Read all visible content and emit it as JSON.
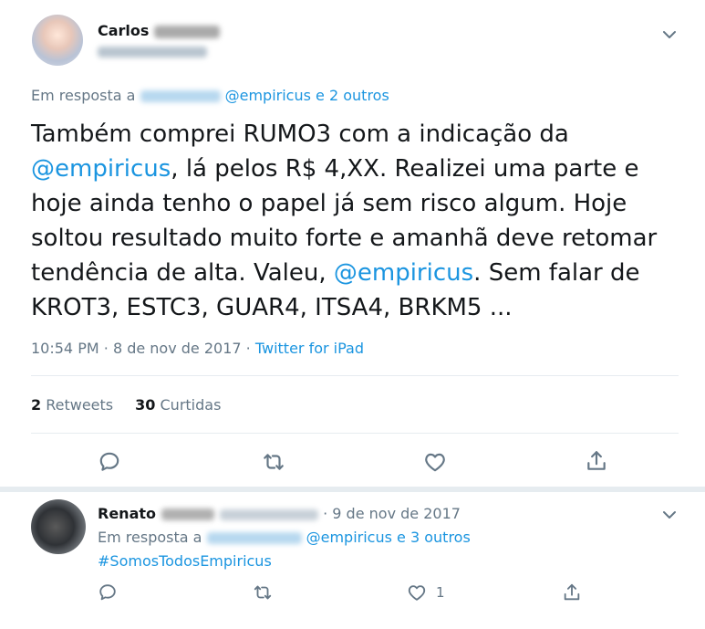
{
  "main_tweet": {
    "author_name": "Carlos",
    "replying_prefix": "Em resposta a",
    "replying_mention": "@empiricus",
    "replying_suffix": "e 2 outros",
    "text_segments": {
      "t1": "Também comprei RUMO3 com a indicação da ",
      "m1": "@empiricus",
      "t2": ", lá pelos R$ 4,XX. Realizei uma parte e hoje ainda tenho o papel já sem risco algum. Hoje soltou resultado muito forte e amanhã deve retomar tendência de alta. Valeu, ",
      "m2": "@empiricus",
      "t3": ". Sem falar de KROT3, ESTC3, GUAR4, ITSA4, BRKM5 ..."
    },
    "time": "10:54 PM",
    "dot": "·",
    "date": "8 de nov de 2017",
    "source": "Twitter for iPad",
    "retweets_count": "2",
    "retweets_label": "Retweets",
    "likes_count": "30",
    "likes_label": "Curtidas"
  },
  "reply_tweet": {
    "author_name": "Renato",
    "dot": "·",
    "date": "9 de nov de 2017",
    "replying_prefix": "Em resposta a",
    "replying_mention": "@empiricus",
    "replying_suffix": "e 3 outros",
    "hashtag": "#SomosTodosEmpiricus",
    "like_count": "1"
  },
  "colors": {
    "link": "#1b95e0",
    "secondary_text": "#657786",
    "primary_text": "#14171a",
    "separator": "#e6ecf0"
  },
  "icons": [
    "chevron-down-icon",
    "reply-icon",
    "retweet-icon",
    "like-icon",
    "share-icon"
  ]
}
